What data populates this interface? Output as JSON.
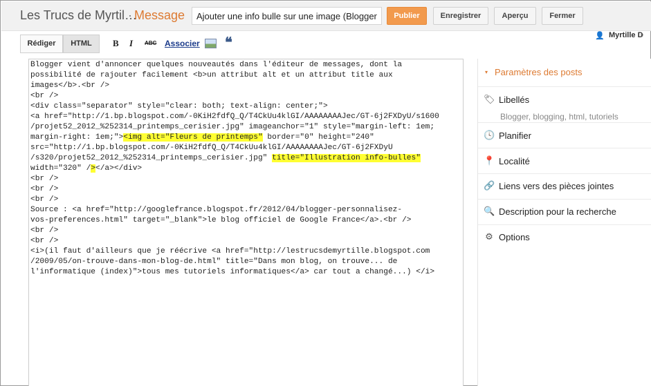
{
  "header": {
    "blog_name": "Les Trucs de Myrtil…",
    "separator": "·",
    "section": "Message",
    "title_value": "Ajouter une info bulle sur une image (Blogger)",
    "publish_label": "Publier",
    "save_label": "Enregistrer",
    "preview_label": "Aperçu",
    "close_label": "Fermer"
  },
  "user": {
    "name": "Myrtille D",
    "avatar_glyph": "👤",
    "caret_glyph": "▾"
  },
  "toolbar": {
    "compose_label": "Rédiger",
    "html_label": "HTML",
    "bold_glyph": "B",
    "italic_glyph": "I",
    "strike_glyph": "ABC",
    "link_label": "Associer",
    "quote_glyph": "❝"
  },
  "editor": {
    "lines": [
      "Blogger vient d'annoncer quelques nouveautés dans l'éditeur de messages, dont la",
      "possibilité de rajouter facilement <b>un attribut alt et un attribut title aux",
      "images</b>.<br />",
      "<br />",
      "<div class=\"separator\" style=\"clear: both; text-align: center;\">",
      "<a href=\"http://1.bp.blogspot.com/-0KiH2fdfQ_Q/T4CkUu4klGI/AAAAAAAAJec/GT-6j2FXDyU/s1600",
      "/projet52_2012_%252314_printemps_cerisier.jpg\" imageanchor=\"1\" style=\"margin-left: 1em;",
      "margin-right: 1em;\">",
      "<img alt=\"Fleurs de printemps\"",
      " border=\"0\" height=\"240\"",
      "src=\"http://1.bp.blogspot.com/-0KiH2fdfQ_Q/T4CkUu4klGI/AAAAAAAAJec/GT-6j2FXDyU",
      "/s320/projet52_2012_%252314_printemps_cerisier.jpg\" ",
      "title=\"Illustration info-bulles\"",
      "width=\"320\" /",
      ">",
      "</a></div>",
      "<br />",
      "<br />",
      "<br />",
      "Source : <a href=\"http://googlefrance.blogspot.fr/2012/04/blogger-personnalisez-",
      "vos-preferences.html\" target=\"_blank\">le blog officiel de Google France</a>.<br />",
      "<br />",
      "<br />",
      "<i>(il faut d'ailleurs que je réécrive <a href=\"http://lestrucsdemyrtille.blogspot.com",
      "/2009/05/on-trouve-dans-mon-blog-de.html\" title=\"Dans mon blog, on trouve... de",
      "l'informatique (index)\">tous mes tutoriels informatiques</a> car tout a changé...) </i>"
    ]
  },
  "sidebar": {
    "header": "Paramètres des posts",
    "header_glyph": "▾",
    "labels_title": "Libellés",
    "labels_value": "Blogger, blogging, html, tutoriels",
    "schedule": "Planifier",
    "location": "Localité",
    "links": "Liens vers des pièces jointes",
    "search_desc": "Description pour la recherche",
    "options": "Options",
    "icons": {
      "labels": "🏷",
      "schedule": "🕓",
      "location": "📍",
      "links": "🔗",
      "search_desc": "🔍",
      "options": "⚙"
    }
  },
  "colors": {
    "accent": "#dd7a31",
    "publish": "#f29a4d",
    "highlight": "#ffff33",
    "link": "#1a3a8a"
  }
}
